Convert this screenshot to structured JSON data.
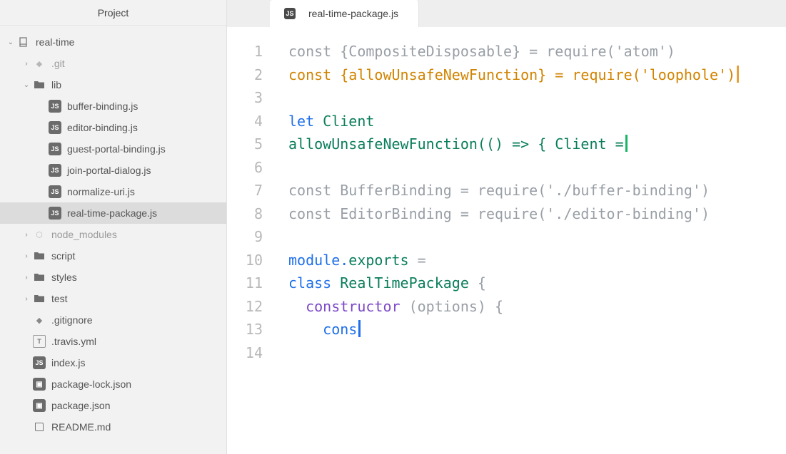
{
  "sidebar": {
    "title": "Project",
    "root": {
      "name": "real-time",
      "expanded": true,
      "items": [
        {
          "name": ".git",
          "type": "git",
          "expanded": false,
          "dim": true
        },
        {
          "name": "lib",
          "type": "folder",
          "expanded": true,
          "dim": false,
          "children": [
            {
              "name": "buffer-binding.js",
              "type": "js"
            },
            {
              "name": "editor-binding.js",
              "type": "js"
            },
            {
              "name": "guest-portal-binding.js",
              "type": "js"
            },
            {
              "name": "join-portal-dialog.js",
              "type": "js"
            },
            {
              "name": "normalize-uri.js",
              "type": "js"
            },
            {
              "name": "real-time-package.js",
              "type": "js",
              "selected": true
            }
          ]
        },
        {
          "name": "node_modules",
          "type": "modules",
          "expanded": false,
          "dim": true
        },
        {
          "name": "script",
          "type": "folder",
          "expanded": false,
          "dim": false
        },
        {
          "name": "styles",
          "type": "folder",
          "expanded": false,
          "dim": false
        },
        {
          "name": "test",
          "type": "folder",
          "expanded": false,
          "dim": false
        },
        {
          "name": ".gitignore",
          "type": "git",
          "dim": false
        },
        {
          "name": ".travis.yml",
          "type": "text",
          "dim": false
        },
        {
          "name": "index.js",
          "type": "js",
          "dim": false
        },
        {
          "name": "package-lock.json",
          "type": "json",
          "dim": false
        },
        {
          "name": "package.json",
          "type": "json",
          "dim": false
        },
        {
          "name": "README.md",
          "type": "book",
          "dim": false
        }
      ]
    }
  },
  "tab": {
    "label": "real-time-package.js"
  },
  "code": {
    "lines": [
      {
        "n": 1,
        "segments": [
          {
            "t": "const ",
            "c": ""
          },
          {
            "t": "{CompositeDisposable}",
            "c": ""
          },
          {
            "t": " = require(",
            "c": ""
          },
          {
            "t": "'atom'",
            "c": ""
          },
          {
            "t": ")",
            "c": ""
          }
        ]
      },
      {
        "n": 2,
        "segments": [
          {
            "t": "const ",
            "c": "new-line"
          },
          {
            "t": "{allowUnsafeNewFunction}",
            "c": "new-line"
          },
          {
            "t": " = require(",
            "c": "new-line"
          },
          {
            "t": "'loophole'",
            "c": "new-line"
          },
          {
            "t": ")",
            "c": "new-line"
          }
        ],
        "cursor": "orange"
      },
      {
        "n": 3,
        "segments": []
      },
      {
        "n": 4,
        "segments": [
          {
            "t": "let ",
            "c": "kw"
          },
          {
            "t": "Client",
            "c": "cls"
          }
        ]
      },
      {
        "n": 5,
        "segments": [
          {
            "t": "allowUnsafeNewFunction",
            "c": "cls"
          },
          {
            "t": "(() => { ",
            "c": "cls"
          },
          {
            "t": "Client",
            "c": "cls"
          },
          {
            "t": " =",
            "c": "cls"
          }
        ],
        "cursor": "green"
      },
      {
        "n": 6,
        "segments": []
      },
      {
        "n": 7,
        "segments": [
          {
            "t": "const ",
            "c": ""
          },
          {
            "t": "BufferBinding = require(",
            "c": ""
          },
          {
            "t": "'./buffer-binding'",
            "c": ""
          },
          {
            "t": ")",
            "c": ""
          }
        ]
      },
      {
        "n": 8,
        "segments": [
          {
            "t": "const ",
            "c": ""
          },
          {
            "t": "EditorBinding = require(",
            "c": ""
          },
          {
            "t": "'./editor-binding'",
            "c": ""
          },
          {
            "t": ")",
            "c": ""
          }
        ]
      },
      {
        "n": 9,
        "segments": []
      },
      {
        "n": 10,
        "segments": [
          {
            "t": "module",
            "c": "modexp"
          },
          {
            "t": ".",
            "c": "modexp"
          },
          {
            "t": "exports",
            "c": "modexpval"
          },
          {
            "t": " =",
            "c": ""
          }
        ]
      },
      {
        "n": 11,
        "segments": [
          {
            "t": "class ",
            "c": "kw"
          },
          {
            "t": "RealTimePackage",
            "c": "cls"
          },
          {
            "t": " {",
            "c": ""
          }
        ]
      },
      {
        "n": 12,
        "segments": [
          {
            "t": "  ",
            "c": ""
          },
          {
            "t": "constructor",
            "c": "fn"
          },
          {
            "t": " (options) {",
            "c": ""
          }
        ]
      },
      {
        "n": 13,
        "segments": [
          {
            "t": "    ",
            "c": ""
          },
          {
            "t": "cons",
            "c": "kw"
          }
        ],
        "cursor": "blue"
      },
      {
        "n": 14,
        "segments": []
      }
    ]
  }
}
